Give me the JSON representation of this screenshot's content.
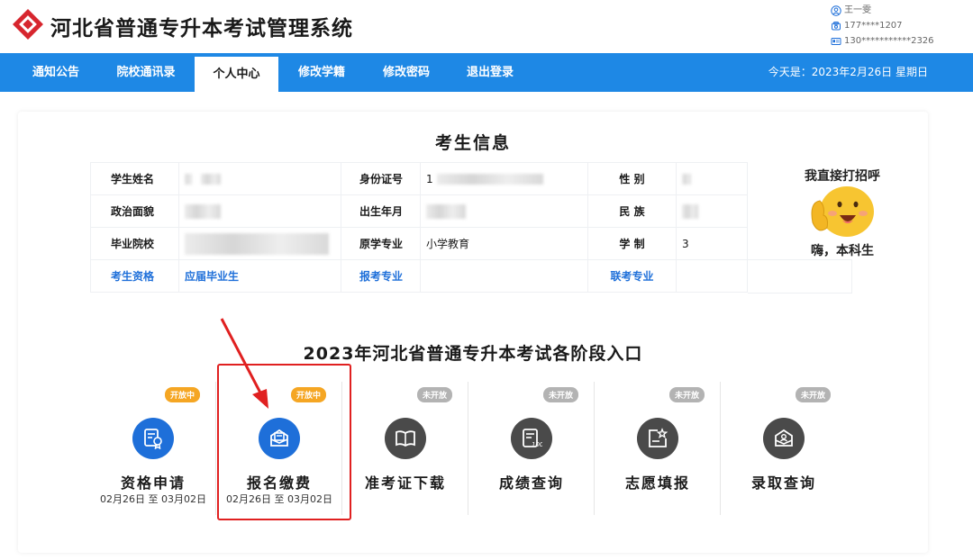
{
  "header": {
    "title": "河北省普通专升本考试管理系统",
    "user_name": "王一雯",
    "phone": "177****1207",
    "id_number": "130***********2326"
  },
  "nav": {
    "items": [
      "通知公告",
      "院校通讯录",
      "个人中心",
      "修改学籍",
      "修改密码",
      "退出登录"
    ],
    "active": "个人中心",
    "date_text": "今天是：2023年2月26日 星期日"
  },
  "info": {
    "title": "考生信息",
    "labels": {
      "name": "学生姓名",
      "id_card": "身份证号",
      "gender": "性 别",
      "politics": "政治面貌",
      "birth": "出生年月",
      "ethnicity": "民 族",
      "school": "毕业院校",
      "major": "原学专业",
      "duration": "学 制",
      "eligibility": "考生资格",
      "apply_major": "报考专业",
      "joint_major": "联考专业"
    },
    "values": {
      "id_card_prefix": "1",
      "major": "小学教育",
      "duration": "3",
      "eligibility": "应届毕业生"
    }
  },
  "sticker": {
    "top_text": "我直接打招呼",
    "bottom_text": "嗨，本科生"
  },
  "stages": {
    "title": "2023年河北省普通专升本考试各阶段入口",
    "items": [
      {
        "name": "资格申请",
        "status": "开放中",
        "date": "02月26日 至 03月02日",
        "icon": "document-badge-icon"
      },
      {
        "name": "报名缴费",
        "status": "开放中",
        "date": "02月26日 至 03月02日",
        "icon": "envelope-icon"
      },
      {
        "name": "准考证下载",
        "status": "未开放",
        "date": "",
        "icon": "book-icon"
      },
      {
        "name": "成绩查询",
        "status": "未开放",
        "date": "",
        "icon": "score-sheet-icon"
      },
      {
        "name": "志愿填报",
        "status": "未开放",
        "date": "",
        "icon": "star-form-icon"
      },
      {
        "name": "录取查询",
        "status": "未开放",
        "date": "",
        "icon": "admission-envelope-icon"
      }
    ]
  },
  "colors": {
    "primary": "#1e88e5",
    "open_badge": "#f5a623",
    "closed_badge": "#b3b3b3",
    "highlight": "#e02020"
  }
}
